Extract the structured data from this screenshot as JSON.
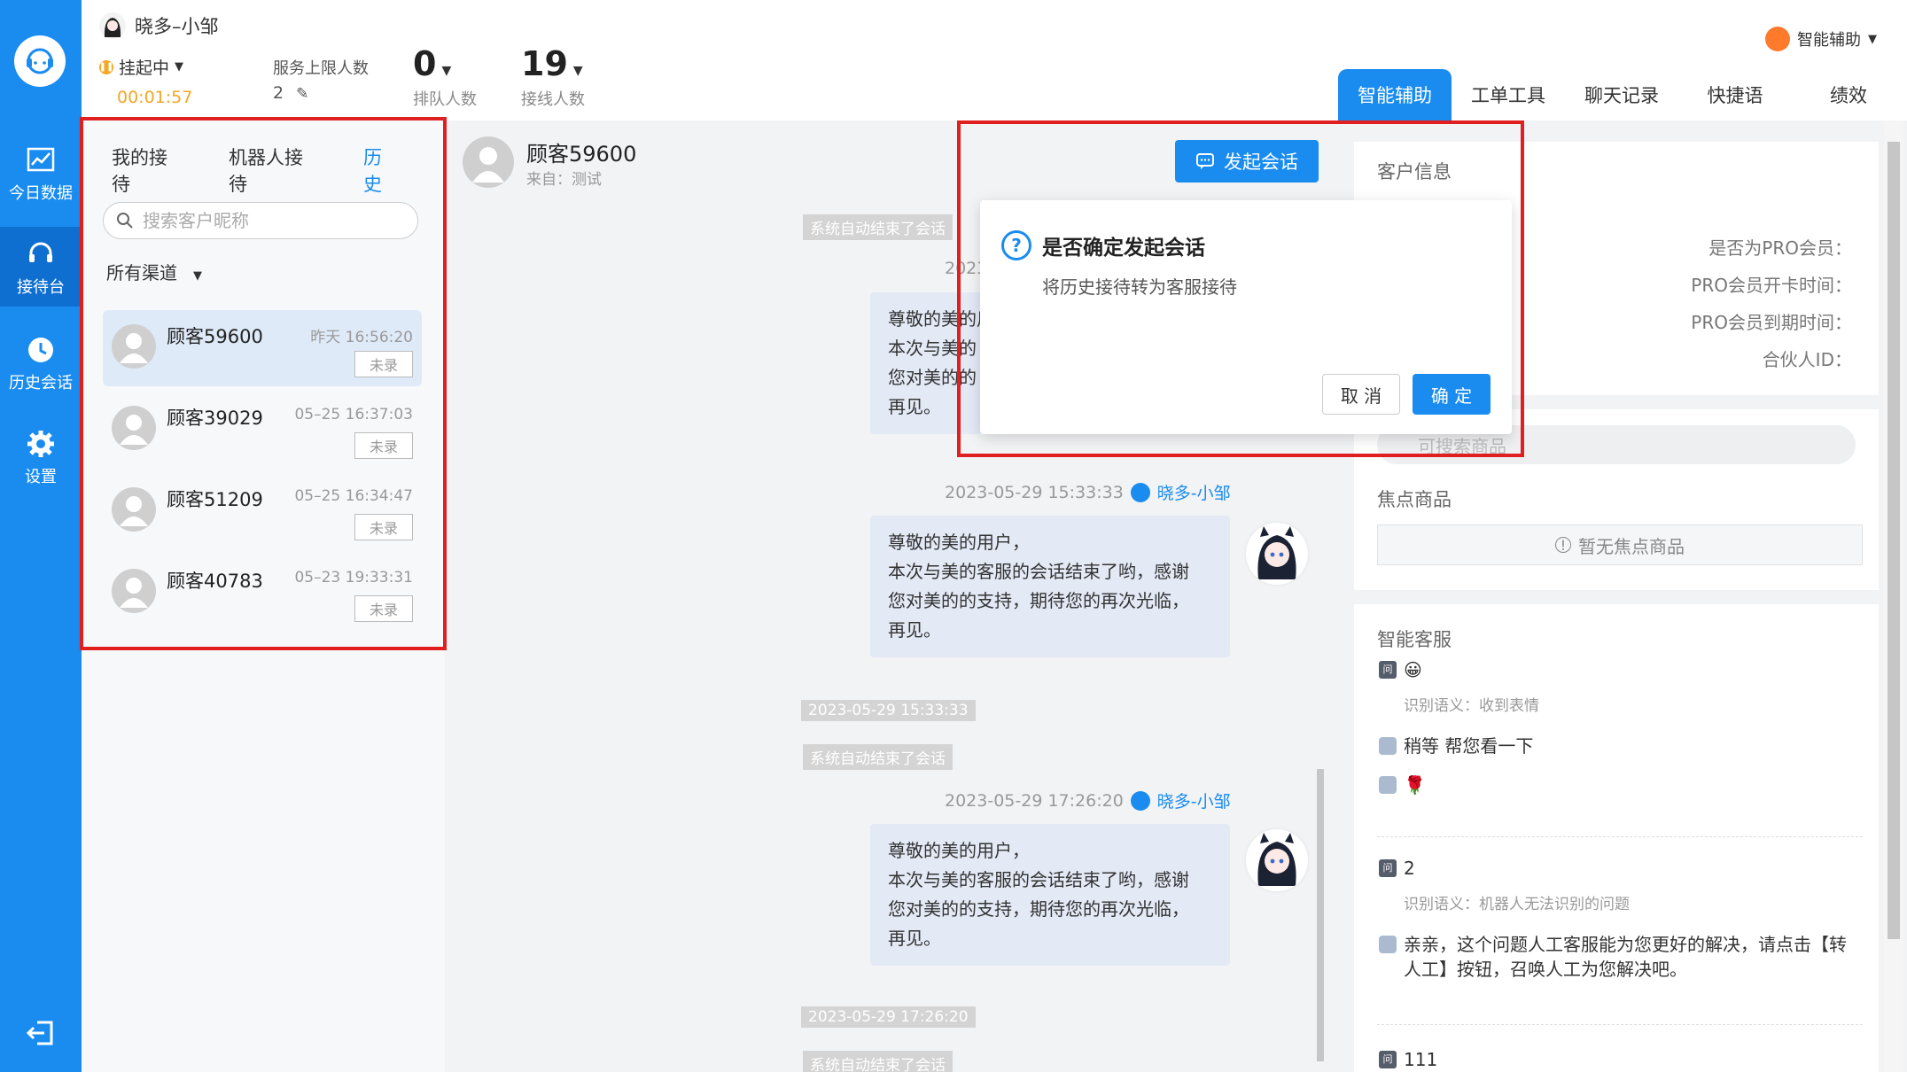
{
  "sidebar": {
    "items": [
      {
        "label": "今日数据",
        "icon": "chart-icon"
      },
      {
        "label": "接待台",
        "icon": "headset-icon"
      },
      {
        "label": "历史会话",
        "icon": "clock-icon"
      },
      {
        "label": "设置",
        "icon": "gear-icon"
      }
    ]
  },
  "header": {
    "agent_name": "晓多–小邹",
    "status": "挂起中",
    "timer": "00:01:57",
    "service_limit_label": "服务上限人数",
    "service_limit_value": "2",
    "queue_count": "0",
    "queue_label": "排队人数",
    "received_count": "19",
    "received_label": "接线人数",
    "assist_label": "智能辅助"
  },
  "right_tabs": [
    "智能辅助",
    "工单工具",
    "聊天记录",
    "快捷语",
    "绩效"
  ],
  "list_panel": {
    "tabs": [
      "我的接待",
      "机器人接待",
      "历史"
    ],
    "search_placeholder": "搜索客户昵称",
    "channel_filter": "所有渠道",
    "conversations": [
      {
        "name": "顾客59600",
        "time": "昨天 16:56:20",
        "tag": "未录"
      },
      {
        "name": "顾客39029",
        "time": "05–25 16:37:03",
        "tag": "未录"
      },
      {
        "name": "顾客51209",
        "time": "05–25 16:34:47",
        "tag": "未录"
      },
      {
        "name": "顾客40783",
        "time": "05–23 19:33:31",
        "tag": "未录"
      }
    ]
  },
  "chat": {
    "customer_name": "顾客59600",
    "customer_from": "来自：测试",
    "start_button": "发起会话",
    "sys_1": "系统自动结束了会话",
    "partial_meta": "2023",
    "msg1_lines": [
      "尊敬的美的用户，",
      "本次与美的",
      "您对美的的",
      "再见。"
    ],
    "msg2_meta_time": "2023-05-29 15:33:33",
    "msg2_meta_sender": "晓多-小邹",
    "msg2_lines": [
      "尊敬的美的用户，",
      "本次与美的客服的会话结束了哟，感谢",
      "您对美的的支持，期待您的再次光临，",
      "再见。"
    ],
    "sys_2_time": "2023-05-29 15:33:33",
    "sys_2": "系统自动结束了会话",
    "msg3_meta_time": "2023-05-29 17:26:20",
    "msg3_meta_sender": "晓多-小邹",
    "msg3_lines": [
      "尊敬的美的用户，",
      "本次与美的客服的会话结束了哟，感谢",
      "您对美的的支持，期待您的再次光临，",
      "再见。"
    ],
    "sys_3_time": "2023-05-29 17:26:20",
    "sys_3": "系统自动结束了会话"
  },
  "dialog": {
    "title": "是否确定发起会话",
    "message": "将历史接待转为客服接待",
    "cancel": "取 消",
    "ok": "确 定"
  },
  "right_panel": {
    "customer_info_title": "客户信息",
    "fields": [
      "是否为PRO会员：",
      "PRO会员开卡时间：",
      "PRO会员到期时间：",
      "合伙人ID："
    ],
    "product_search_placeholder": "可搜索商品",
    "focus_title": "焦点商品",
    "focus_empty": "暂无焦点商品",
    "smart_title": "智能客服",
    "qa_badge": "问",
    "qa": [
      {
        "q": "😀",
        "semantic": "识别语义：收到表情",
        "answers": [
          "稍等 帮您看一下",
          "🌹"
        ]
      },
      {
        "q": "2",
        "semantic": "识别语义：机器人无法识别的问题",
        "answers": [
          "亲亲，这个问题人工客服能为您更好的解决，请点击【转人工】按钮，召唤人工为您解决吧。"
        ]
      },
      {
        "q": "111"
      }
    ]
  },
  "colors": {
    "primary": "#1a8cf0",
    "highlight": "#e02020",
    "status": "#f5a623"
  }
}
